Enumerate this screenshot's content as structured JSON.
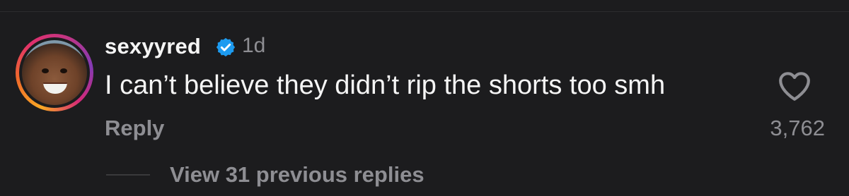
{
  "comment": {
    "username": "sexyyred",
    "verified_icon": "verified-badge-icon",
    "verified_color": "#1d9bf0",
    "time_ago": "1d",
    "text": "I can’t believe they didn’t rip the shorts too smh",
    "reply_label": "Reply",
    "like_icon": "heart-outline-icon",
    "like_count": "3,762",
    "view_replies_label": "View 31 previous replies"
  },
  "colors": {
    "background": "#1c1c1e",
    "primary_text": "#f5f5f5",
    "secondary_text": "#8e8e93"
  }
}
